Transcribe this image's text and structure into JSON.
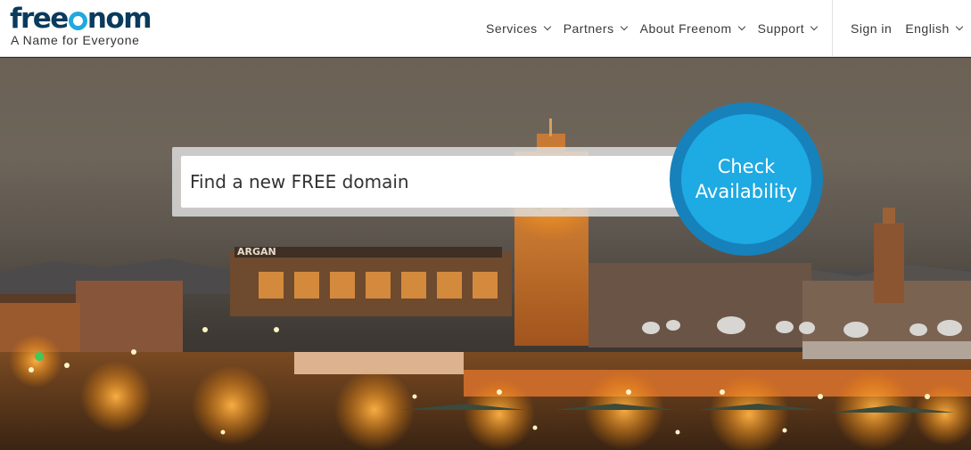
{
  "logo": {
    "wordmark_prefix": "free",
    "wordmark_suffix": "nom",
    "tagline": "A Name for Everyone"
  },
  "nav": {
    "left": [
      {
        "label": "Services"
      },
      {
        "label": "Partners"
      },
      {
        "label": "About Freenom"
      },
      {
        "label": "Support"
      }
    ],
    "sign_in": "Sign in",
    "language": "English"
  },
  "hero": {
    "search_placeholder": "Find a new FREE domain",
    "check_line1": "Check",
    "check_line2": "Availability",
    "sign_argan": "ARGAN"
  },
  "colors": {
    "brand_dark": "#0a3a5c",
    "brand_blue": "#1eaae3",
    "button_ring": "#1781bb"
  }
}
